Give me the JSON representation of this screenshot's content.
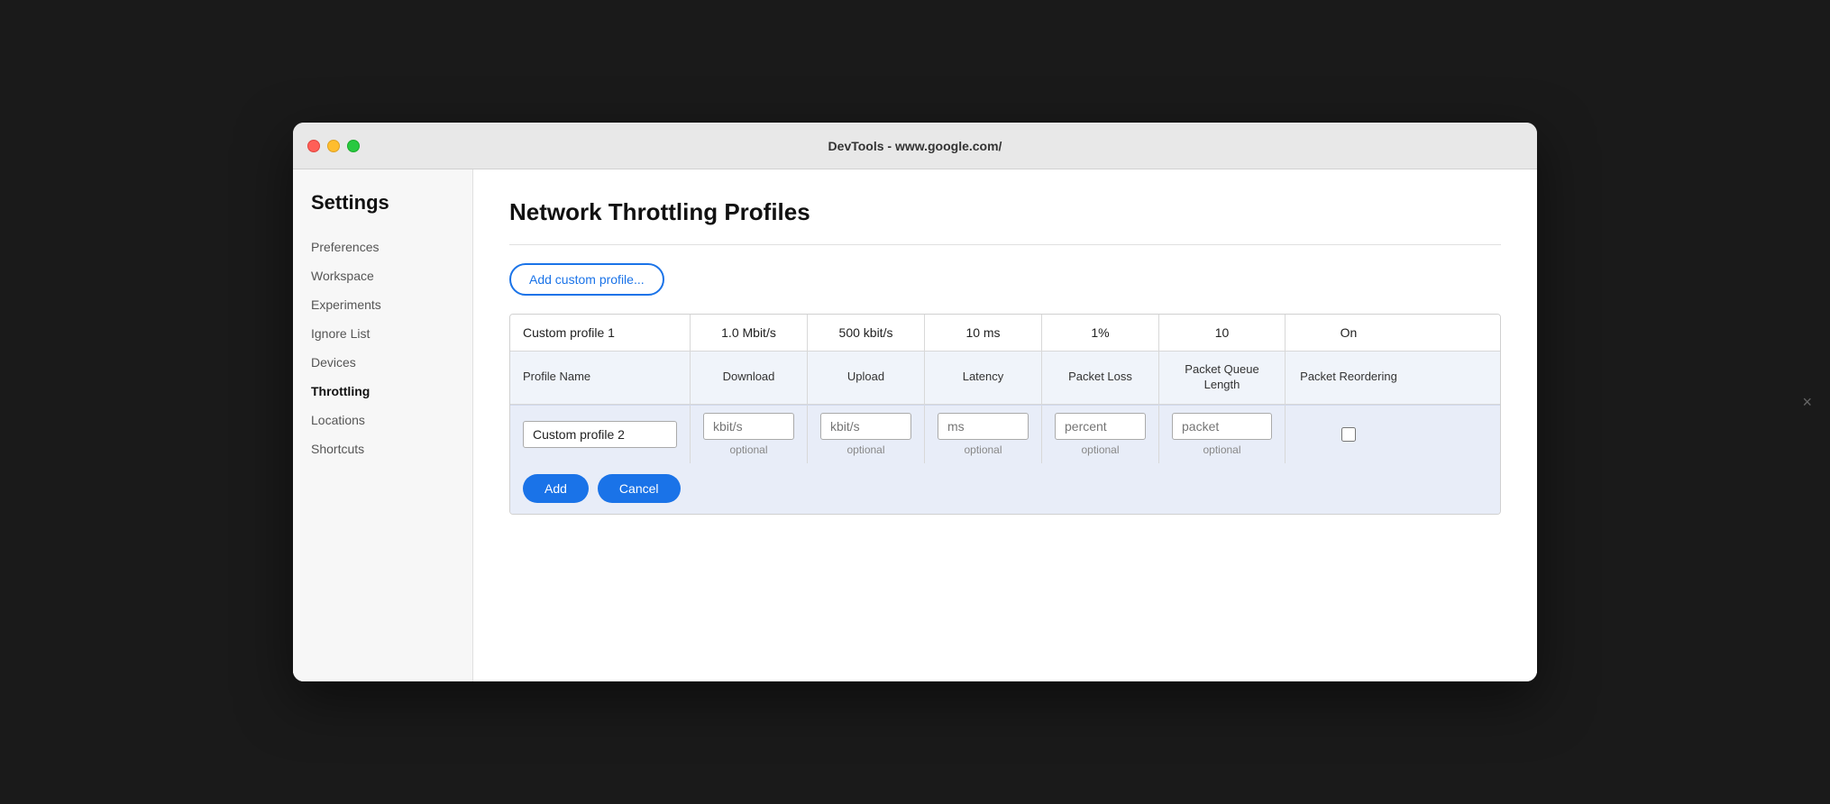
{
  "titlebar": {
    "title": "DevTools - www.google.com/"
  },
  "sidebar": {
    "title": "Settings",
    "items": [
      {
        "label": "Preferences",
        "active": false
      },
      {
        "label": "Workspace",
        "active": false
      },
      {
        "label": "Experiments",
        "active": false
      },
      {
        "label": "Ignore List",
        "active": false
      },
      {
        "label": "Devices",
        "active": false
      },
      {
        "label": "Throttling",
        "active": true
      },
      {
        "label": "Locations",
        "active": false
      },
      {
        "label": "Shortcuts",
        "active": false
      }
    ]
  },
  "main": {
    "page_title": "Network Throttling Profiles",
    "add_button_label": "Add custom profile...",
    "close_button": "×",
    "table": {
      "columns": [
        "Profile Name",
        "Download",
        "Upload",
        "Latency",
        "Packet Loss",
        "Packet Queue Length",
        "Packet Reordering"
      ],
      "existing_rows": [
        {
          "name": "Custom profile 1",
          "download": "1.0 Mbit/s",
          "upload": "500 kbit/s",
          "latency": "10 ms",
          "packet_loss": "1%",
          "packet_queue": "10",
          "packet_reorder": "On"
        }
      ],
      "add_form": {
        "name_value": "Custom profile 2",
        "name_placeholder": "",
        "download_placeholder": "kbit/s",
        "download_hint": "optional",
        "upload_placeholder": "kbit/s",
        "upload_hint": "optional",
        "latency_placeholder": "ms",
        "latency_hint": "optional",
        "packet_loss_placeholder": "percent",
        "packet_loss_hint": "optional",
        "packet_queue_placeholder": "packet",
        "packet_queue_hint": "optional"
      },
      "add_label": "Add",
      "cancel_label": "Cancel"
    }
  }
}
